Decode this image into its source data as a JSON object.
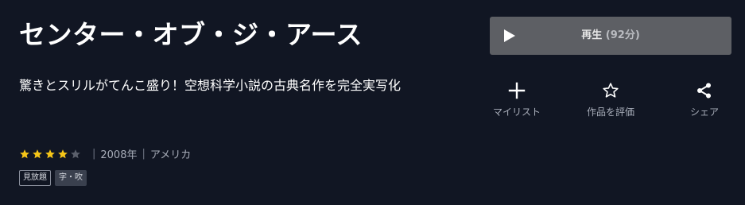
{
  "title": "センター・オブ・ジ・アース",
  "catchcopy": "驚きとスリルがてんこ盛り！空想科学小説の古典名作を完全実写化",
  "rating": {
    "stars_filled": 4,
    "stars_total": 5,
    "filled_color": "#f5c518",
    "empty_color": "#5a5f6b"
  },
  "meta": {
    "year": "2008年",
    "country": "アメリカ",
    "separator": "|"
  },
  "badges": {
    "unlimited": "見放題",
    "subtitle_dub": "字・吹"
  },
  "play": {
    "label": "再生",
    "duration": "(92分)",
    "icon": "play-icon"
  },
  "actions": {
    "mylist": {
      "label": "マイリスト",
      "icon": "plus-icon"
    },
    "rate": {
      "label": "作品を評価",
      "icon": "star-outline-icon"
    },
    "share": {
      "label": "シェア",
      "icon": "share-icon"
    }
  }
}
